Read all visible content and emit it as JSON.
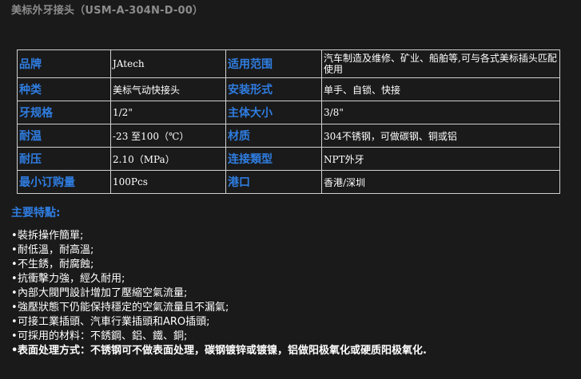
{
  "title": "美标外牙接头（USM-A-304N-D-00）",
  "specs": {
    "rows": [
      {
        "l1": "品牌",
        "v1": "JAtech",
        "l2": "适用范围",
        "v2": "汽车制造及维修、矿业、船舶等,可与各式美标插头匹配使用"
      },
      {
        "l1": "种类",
        "v1": "美标气动快接头",
        "l2": "安装形式",
        "v2": "单手、自锁、快接"
      },
      {
        "l1": "牙规格",
        "v1": "1/2\"",
        "l2": "主体大小",
        "v2": "3/8\""
      },
      {
        "l1": "耐温",
        "v1": "-23 至100（℃）",
        "l2": "材质",
        "v2": "304不锈钢，可做碳钢、铜或铝"
      },
      {
        "l1": "耐压",
        "v1": "2.10（MPa）",
        "l2": "连接類型",
        "v2": "NPT外牙"
      },
      {
        "l1": "最小订购量",
        "v1": "100Pcs",
        "l2": "港口",
        "v2": "香港/深圳"
      }
    ]
  },
  "features": {
    "heading": "主要特點:",
    "bullet": "•",
    "items": [
      "裝拆操作簡單;",
      "耐低溫，耐高溫;",
      "不生銹，耐腐蝕;",
      "抗衝擊力強，經久耐用;",
      "內部大閥門設計增加了壓縮空氣流量;",
      "強壓狀態下仍能保持穩定的空氣流量且不漏氣;",
      "可接工業插頭、汽車行業插頭和ARO插頭;",
      "可採用的材料：不銹鋼、鋁、鐵、銅;",
      "表面处理方式：不锈钢可不做表面处理，碳钢镀锌或镀镍，铝做阳极氧化或硬质阳极氧化."
    ]
  },
  "colors": {
    "background": "#1a1a1a",
    "label": "#2f7de1",
    "title": "#8c8c8c",
    "border": "#d0d0d0"
  }
}
